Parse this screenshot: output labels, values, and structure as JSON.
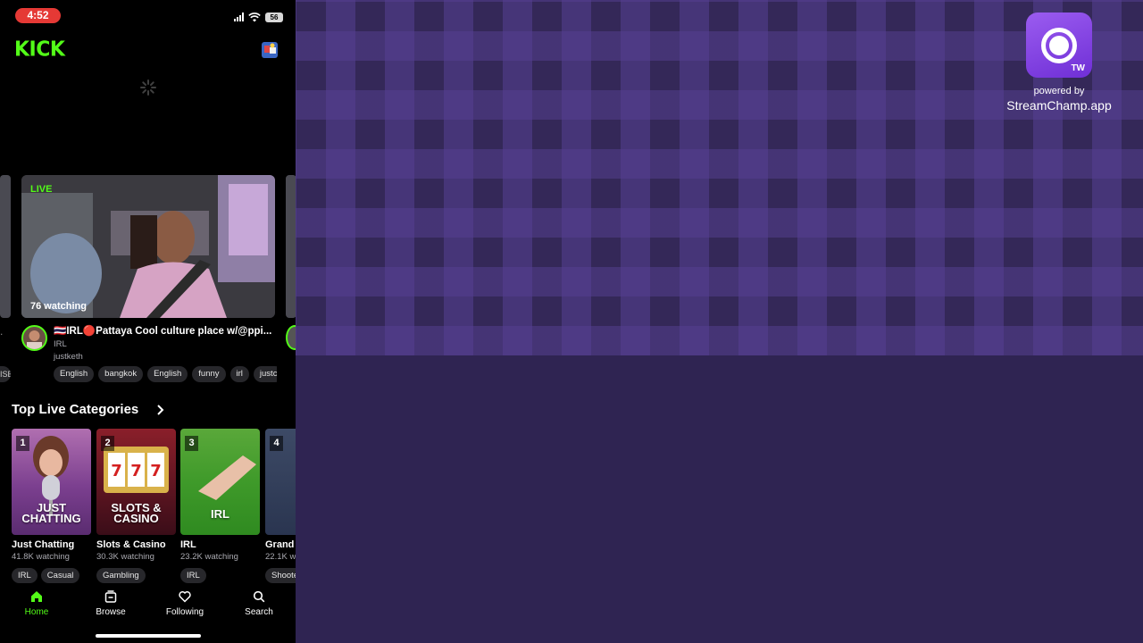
{
  "status_bar": {
    "time": "4:52",
    "battery": "56"
  },
  "app": {
    "logo": "KICK",
    "accent": "#53fc18"
  },
  "featured_stream": {
    "live_label": "LIVE",
    "viewers": "76 watching",
    "title": "🇹🇭IRL🔴Pattaya Cool culture place w/@ppi...",
    "category": "IRL",
    "username": "justketh",
    "tags": [
      "English",
      "bangkok",
      "English",
      "funny",
      "irl",
      "justc"
    ]
  },
  "side_peek": {
    "left_tag": "ISE"
  },
  "top_categories": {
    "title": "Top Live Categories",
    "items": [
      {
        "rank": "1",
        "art": "JUST CHATTING",
        "name": "Just Chatting",
        "viewers": "41.8K watching",
        "tags": [
          "IRL",
          "Casual"
        ]
      },
      {
        "rank": "2",
        "art": "SLOTS & CASINO",
        "name": "Slots & Casino",
        "viewers": "30.3K watching",
        "tags": [
          "Gambling"
        ]
      },
      {
        "rank": "3",
        "art": "IRL",
        "name": "IRL",
        "viewers": "23.2K watching",
        "tags": [
          "IRL"
        ]
      },
      {
        "rank": "4",
        "art": "",
        "name": "Grand",
        "viewers": "22.1K w",
        "tags": [
          "Shoote"
        ]
      }
    ]
  },
  "bottom_nav": [
    {
      "label": "Home",
      "icon": "home-icon",
      "active": true
    },
    {
      "label": "Browse",
      "icon": "browse-icon",
      "active": false
    },
    {
      "label": "Following",
      "icon": "heart-icon",
      "active": false
    },
    {
      "label": "Search",
      "icon": "search-icon",
      "active": false
    }
  ],
  "overlay": {
    "powered_by": "powered by",
    "brand": "StreamChamp.app",
    "badge": "TW"
  }
}
